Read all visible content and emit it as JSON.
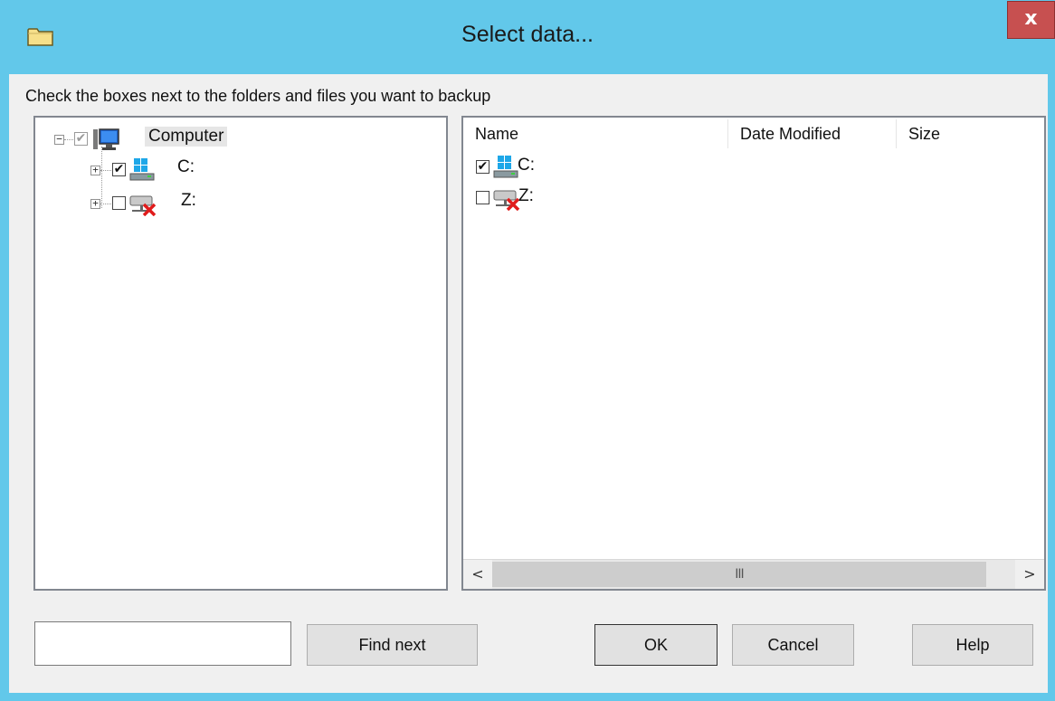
{
  "window": {
    "title": "Select data..."
  },
  "close": {
    "label": "x"
  },
  "instruction": "Check the boxes next to the folders and files you want to backup",
  "tree": {
    "root": {
      "label": "Computer",
      "checked": true,
      "expanded": true
    },
    "children": [
      {
        "label": "C:",
        "checked": true,
        "icon": "windows-drive-icon"
      },
      {
        "label": "Z:",
        "checked": false,
        "icon": "disconnected-network-drive-icon"
      }
    ]
  },
  "list": {
    "columns": [
      "Name",
      "Date Modified",
      "Size"
    ],
    "rows": [
      {
        "name": "C:",
        "checked": true,
        "icon": "windows-drive-icon"
      },
      {
        "name": "Z:",
        "checked": false,
        "icon": "disconnected-network-drive-icon"
      }
    ],
    "scroll": {
      "left": "<",
      "right": ">",
      "thumb": "III"
    }
  },
  "footer": {
    "search_value": "",
    "find_next": "Find next",
    "ok": "OK",
    "cancel": "Cancel",
    "help": "Help"
  },
  "glyphs": {
    "check": "✔",
    "expander_minus": "−",
    "expander_plus": "+"
  },
  "colors": {
    "titlebar": "#62c8ea",
    "close": "#c75050",
    "panel_bg": "#f0f0f0"
  }
}
